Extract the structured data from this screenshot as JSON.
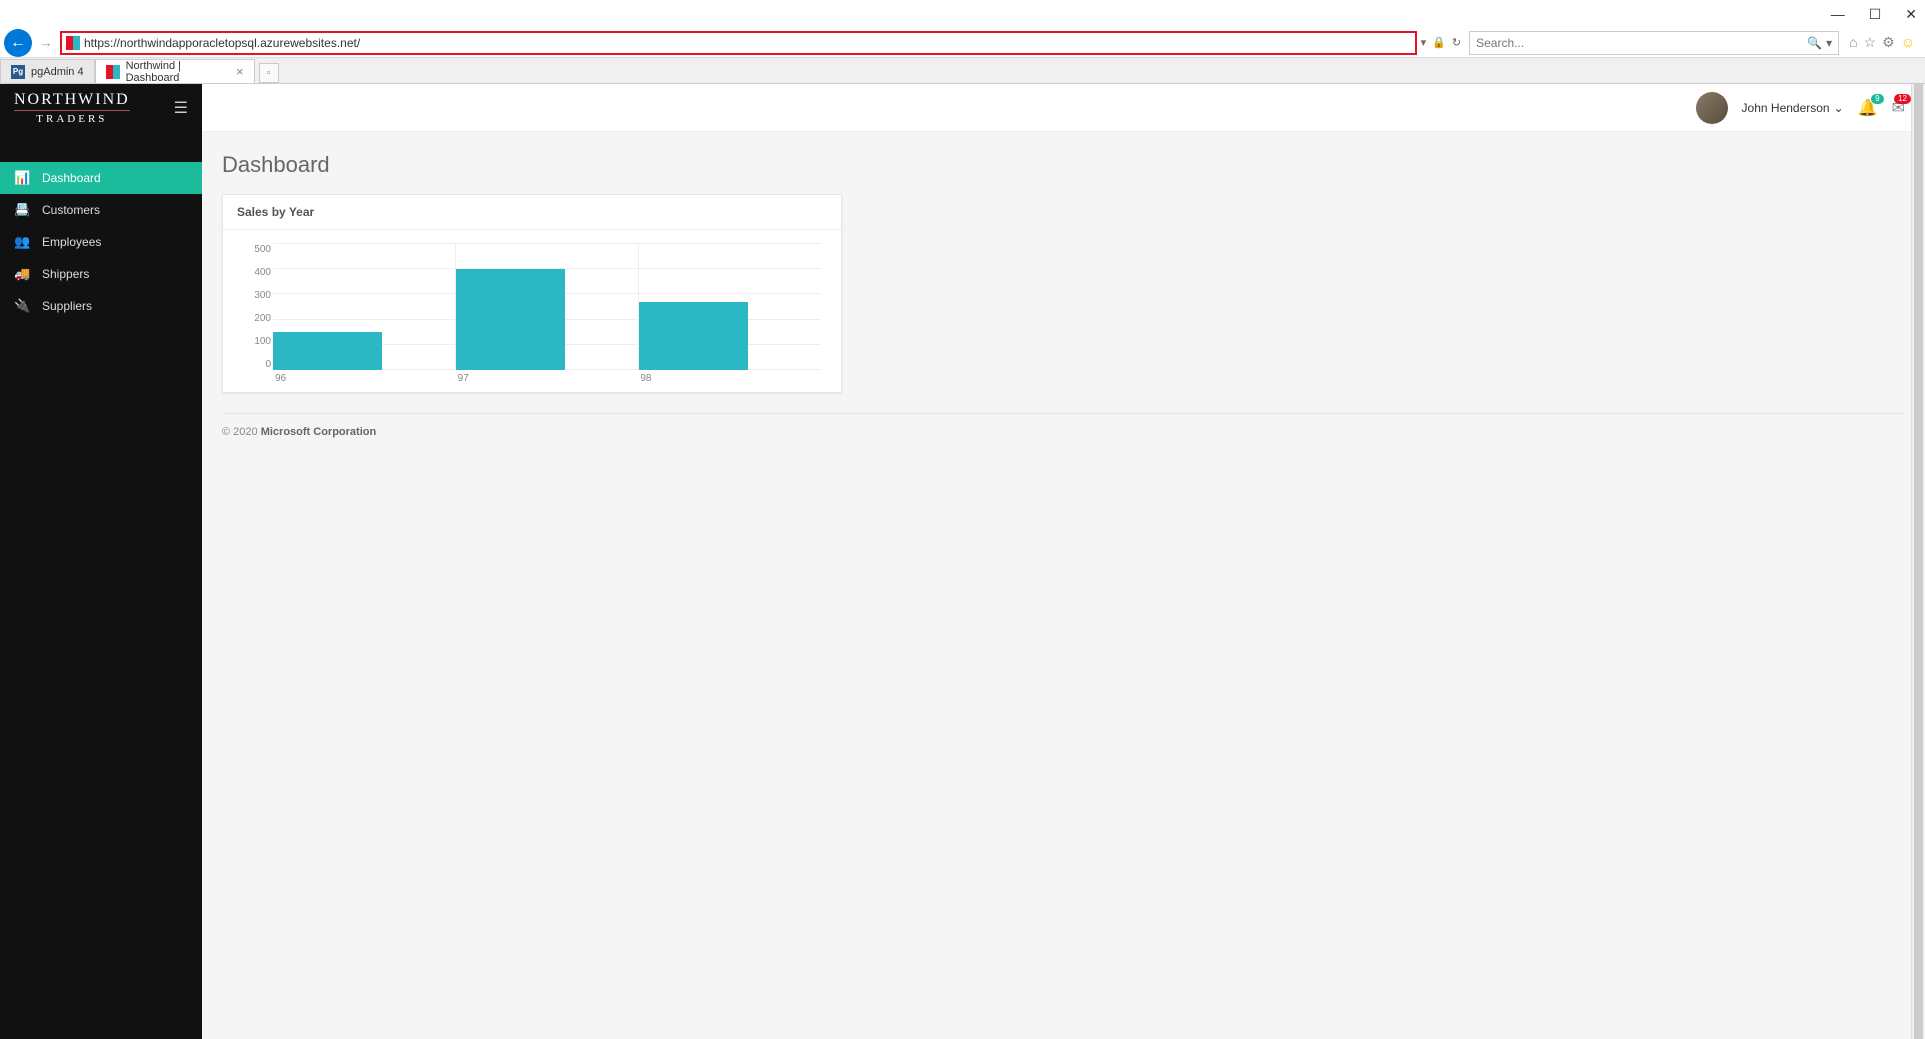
{
  "window_controls": {
    "min": "—",
    "max": "☐",
    "close": "✕"
  },
  "browser": {
    "url": "https://northwindapporacletopsql.azurewebsites.net/",
    "search_placeholder": "Search...",
    "tabs": [
      {
        "label": "pgAdmin 4"
      },
      {
        "label": "Northwind | Dashboard"
      }
    ]
  },
  "sidebar": {
    "logo_top": "NORTHWIND",
    "logo_bottom": "TRADERS",
    "items": [
      {
        "icon": "📊",
        "label": "Dashboard",
        "active": true
      },
      {
        "icon": "📇",
        "label": "Customers",
        "active": false
      },
      {
        "icon": "👥",
        "label": "Employees",
        "active": false
      },
      {
        "icon": "🚚",
        "label": "Shippers",
        "active": false
      },
      {
        "icon": "🔌",
        "label": "Suppliers",
        "active": false
      }
    ]
  },
  "topbar": {
    "username": "John Henderson",
    "notif_badge": "9",
    "msg_badge": "12"
  },
  "page": {
    "title": "Dashboard",
    "card_title": "Sales by Year",
    "footer_prefix": "© 2020 ",
    "footer_company": "Microsoft Corporation"
  },
  "chart_data": {
    "type": "bar",
    "title": "Sales by Year",
    "categories": [
      "96",
      "97",
      "98"
    ],
    "values": [
      150,
      400,
      270
    ],
    "y_ticks": [
      0,
      100,
      200,
      300,
      400,
      500
    ],
    "ylim": [
      0,
      500
    ],
    "xlabel": "",
    "ylabel": ""
  },
  "colors": {
    "accent": "#1abc9c",
    "bar": "#2bb8c4",
    "sidebar_bg": "#111",
    "danger": "#e81123"
  }
}
